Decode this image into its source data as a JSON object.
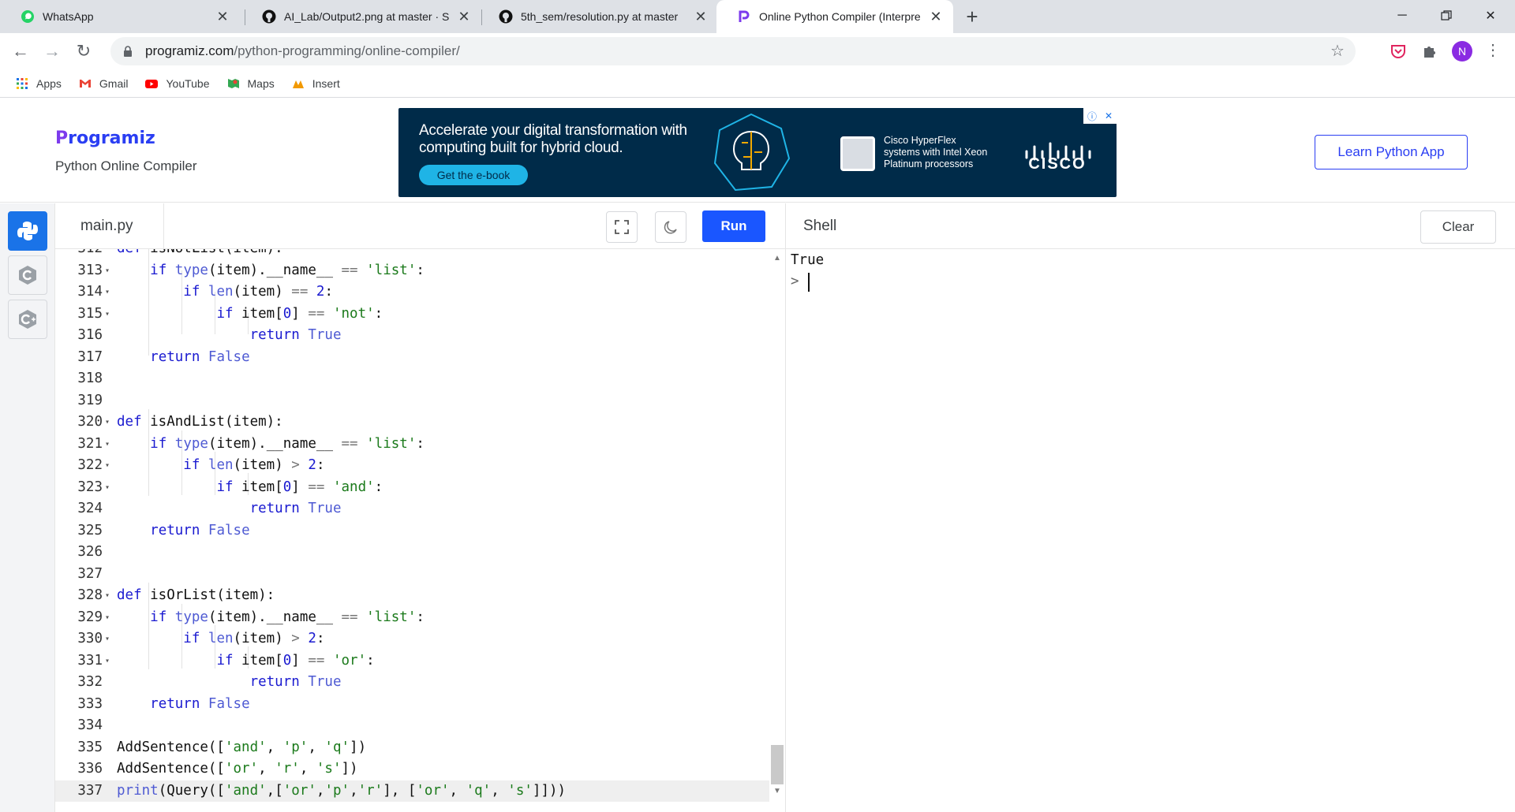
{
  "browser": {
    "tabs": [
      {
        "title": "WhatsApp",
        "icon": "whatsapp-icon"
      },
      {
        "title": "AI_Lab/Output2.png at master · S",
        "icon": "github-icon"
      },
      {
        "title": "5th_sem/resolution.py at master",
        "icon": "github-icon"
      },
      {
        "title": "Online Python Compiler (Interpre",
        "icon": "programiz-icon",
        "active": true
      }
    ],
    "new_tab": "+",
    "url_host": "programiz.com",
    "url_path": "/python-programming/online-compiler/",
    "profile_initial": "N",
    "bookmarks": [
      {
        "label": "Apps",
        "icon": "apps-grid-icon"
      },
      {
        "label": "Gmail",
        "icon": "gmail-icon"
      },
      {
        "label": "YouTube",
        "icon": "youtube-icon"
      },
      {
        "label": "Maps",
        "icon": "maps-icon"
      },
      {
        "label": "Insert",
        "icon": "insert-icon"
      }
    ]
  },
  "site": {
    "logo": "Programiz",
    "logo_first": "P",
    "logo_rest": "rogramiz",
    "subtitle": "Python Online Compiler",
    "learn_button": "Learn Python App"
  },
  "ad": {
    "headline": "Accelerate your digital transformation with computing built for hybrid cloud.",
    "cta": "Get the e-book",
    "chip_text": "Cisco HyperFlex systems with Intel Xeon Platinum processors",
    "brand": "CISCO"
  },
  "editor": {
    "file_name": "main.py",
    "run_label": "Run"
  },
  "shell": {
    "title": "Shell",
    "clear_label": "Clear",
    "output": "True",
    "prompt": ">"
  },
  "colors": {
    "accent": "#1a56ff",
    "brand_blue": "#2a3ef3",
    "ad_background": "#002b49"
  }
}
